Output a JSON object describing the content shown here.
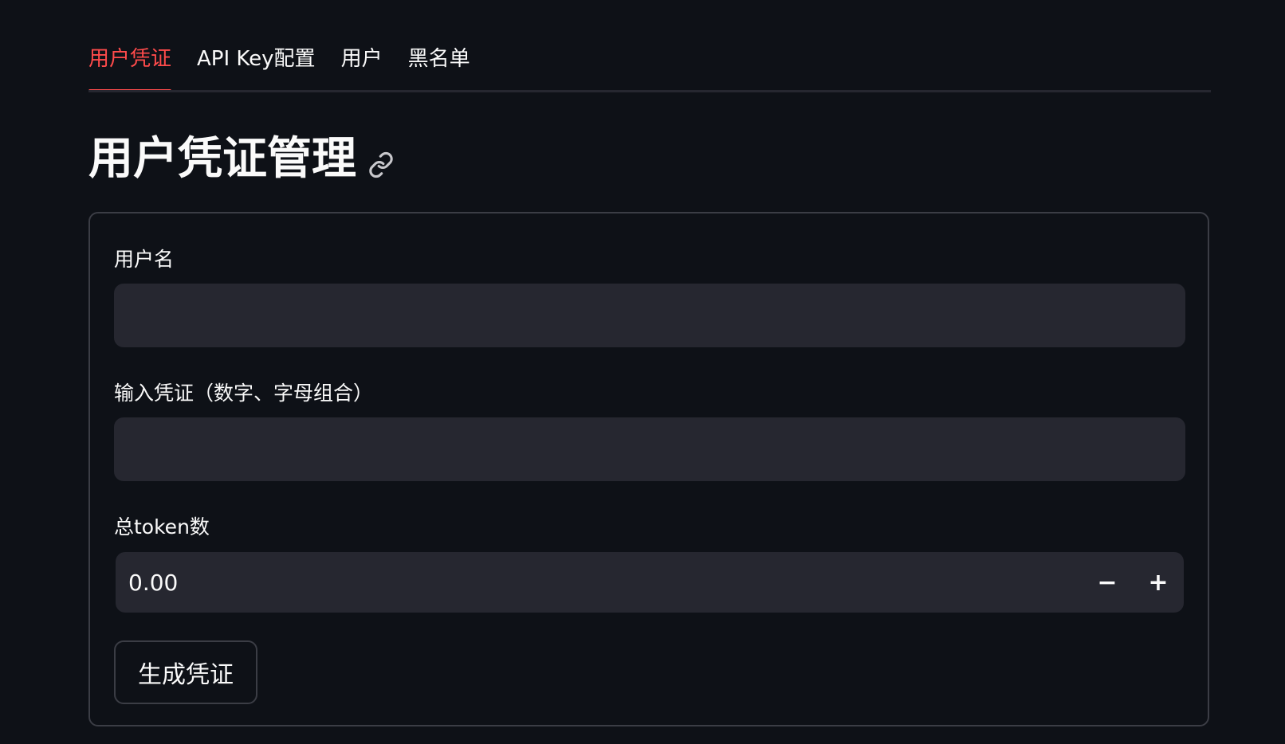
{
  "tabs": [
    {
      "label": "用户凭证",
      "active": true
    },
    {
      "label": "API Key配置",
      "active": false
    },
    {
      "label": "用户",
      "active": false
    },
    {
      "label": "黑名单",
      "active": false
    }
  ],
  "page": {
    "title": "用户凭证管理",
    "title_icon": "link-icon"
  },
  "form": {
    "username": {
      "label": "用户名",
      "value": "",
      "placeholder": ""
    },
    "credential": {
      "label": "输入凭证（数字、字母组合）",
      "value": "",
      "placeholder": ""
    },
    "total_tokens": {
      "label": "总token数",
      "value": "0.00",
      "decrement": "−",
      "increment": "+"
    },
    "submit_label": "生成凭证"
  },
  "colors": {
    "background": "#0e1117",
    "accent": "#ff4b4b",
    "input_bg": "#262730",
    "border": "#3b3d45",
    "text": "#fafafa"
  }
}
